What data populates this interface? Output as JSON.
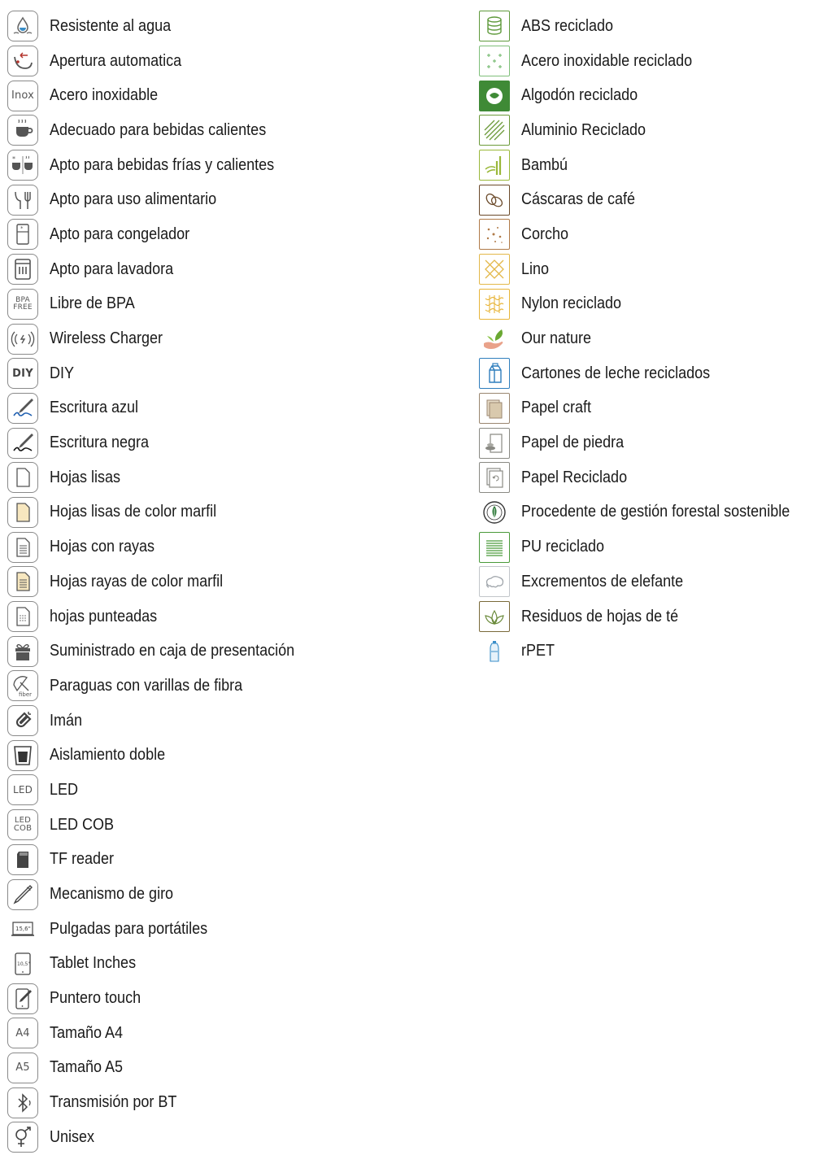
{
  "left_items": [
    {
      "icon": "water-drop-icon",
      "label": "Resistente al agua"
    },
    {
      "icon": "auto-open-icon",
      "label": "Apertura automatica"
    },
    {
      "icon": "inox-icon",
      "label": "Acero inoxidable",
      "icon_text": "Inox"
    },
    {
      "icon": "hot-drink-icon",
      "label": "Adecuado para bebidas calientes"
    },
    {
      "icon": "hot-cold-drink-icon",
      "label": "Apto para bebidas frías y calientes"
    },
    {
      "icon": "food-safe-icon",
      "label": "Apto para uso alimentario"
    },
    {
      "icon": "freezer-icon",
      "label": "Apto para congelador"
    },
    {
      "icon": "dishwasher-icon",
      "label": "Apto para lavadora"
    },
    {
      "icon": "bpa-free-icon",
      "label": "Libre de BPA",
      "icon_text": "BPA\nFREE"
    },
    {
      "icon": "wireless-charge-icon",
      "label": "Wireless Charger"
    },
    {
      "icon": "diy-icon",
      "label": "DIY",
      "icon_text": "DIY"
    },
    {
      "icon": "pen-blue-icon",
      "label": "Escritura azul"
    },
    {
      "icon": "pen-black-icon",
      "label": "Escritura negra"
    },
    {
      "icon": "blank-sheet-icon",
      "label": "Hojas lisas"
    },
    {
      "icon": "ivory-sheet-icon",
      "label": "Hojas lisas de color marfil"
    },
    {
      "icon": "lined-sheet-icon",
      "label": "Hojas con rayas"
    },
    {
      "icon": "ivory-lined-sheet-icon",
      "label": "Hojas rayas de color marfil"
    },
    {
      "icon": "dotted-sheet-icon",
      "label": "hojas punteadas"
    },
    {
      "icon": "gift-box-icon",
      "label": "Suministrado en caja de presentación"
    },
    {
      "icon": "umbrella-fiber-icon",
      "label": "Paraguas con varillas de fibra",
      "icon_text": "fiber"
    },
    {
      "icon": "magnet-icon",
      "label": "Imán"
    },
    {
      "icon": "double-wall-icon",
      "label": "Aislamiento doble"
    },
    {
      "icon": "led-icon",
      "label": "LED",
      "icon_text": "LED"
    },
    {
      "icon": "led-cob-icon",
      "label": "LED COB",
      "icon_text": "LED\nCOB"
    },
    {
      "icon": "sd-card-icon",
      "label": "TF reader"
    },
    {
      "icon": "twist-pen-icon",
      "label": "Mecanismo de giro"
    },
    {
      "icon": "laptop-inches-icon",
      "label": "Pulgadas para portátiles",
      "icon_text": "15,6\""
    },
    {
      "icon": "tablet-inches-icon",
      "label": "Tablet Inches",
      "icon_text": "10,5\""
    },
    {
      "icon": "touch-stylus-icon",
      "label": "Puntero touch"
    },
    {
      "icon": "a4-icon",
      "label": "Tamaño A4",
      "icon_text": "A4"
    },
    {
      "icon": "a5-icon",
      "label": "Tamaño A5",
      "icon_text": "A5"
    },
    {
      "icon": "bluetooth-icon",
      "label": "Transmisión por BT"
    },
    {
      "icon": "unisex-icon",
      "label": "Unisex"
    }
  ],
  "right_items": [
    {
      "icon": "abs-recycled-icon",
      "label": "ABS reciclado",
      "color": "#5f9a3c"
    },
    {
      "icon": "recycled-steel-icon",
      "label": "Acero inoxidable reciclado",
      "color": "#7fbf7a"
    },
    {
      "icon": "recycled-cotton-icon",
      "label": "Algodón reciclado",
      "color": "#3f8a36"
    },
    {
      "icon": "recycled-aluminium-icon",
      "label": "Aluminio Reciclado",
      "color": "#6c9a3a"
    },
    {
      "icon": "bamboo-icon",
      "label": "Bambú",
      "color": "#9ab83a"
    },
    {
      "icon": "coffee-husk-icon",
      "label": "Cáscaras de café",
      "color": "#6b4a2a"
    },
    {
      "icon": "cork-icon",
      "label": "Corcho",
      "color": "#b07a48"
    },
    {
      "icon": "linen-icon",
      "label": "Lino",
      "color": "#e3b84a"
    },
    {
      "icon": "recycled-nylon-icon",
      "label": "Nylon reciclado",
      "color": "#e8b53a"
    },
    {
      "icon": "our-nature-icon",
      "label": "Our nature",
      "color": "#6aa832"
    },
    {
      "icon": "milk-carton-icon",
      "label": "Cartones de leche reciclados",
      "color": "#2f7ebd"
    },
    {
      "icon": "craft-paper-icon",
      "label": "Papel craft",
      "color": "#9a8670"
    },
    {
      "icon": "stone-paper-icon",
      "label": "Papel de piedra",
      "color": "#8a8a84"
    },
    {
      "icon": "recycled-paper-icon",
      "label": "Papel Reciclado",
      "color": "#8a8a84"
    },
    {
      "icon": "sustainable-forest-icon",
      "label": "Procedente de gestión forestal sostenible",
      "color": "#2f7a3a"
    },
    {
      "icon": "recycled-pu-icon",
      "label": "PU reciclado",
      "color": "#4a9a3a"
    },
    {
      "icon": "elephant-dung-icon",
      "label": "Excrementos de elefante",
      "color": "#9aa0a6"
    },
    {
      "icon": "tea-leaves-icon",
      "label": "Residuos de hojas de té",
      "color": "#7a6a3a"
    },
    {
      "icon": "rpet-bottle-icon",
      "label": "rPET",
      "color": "#3a8ec8"
    }
  ]
}
